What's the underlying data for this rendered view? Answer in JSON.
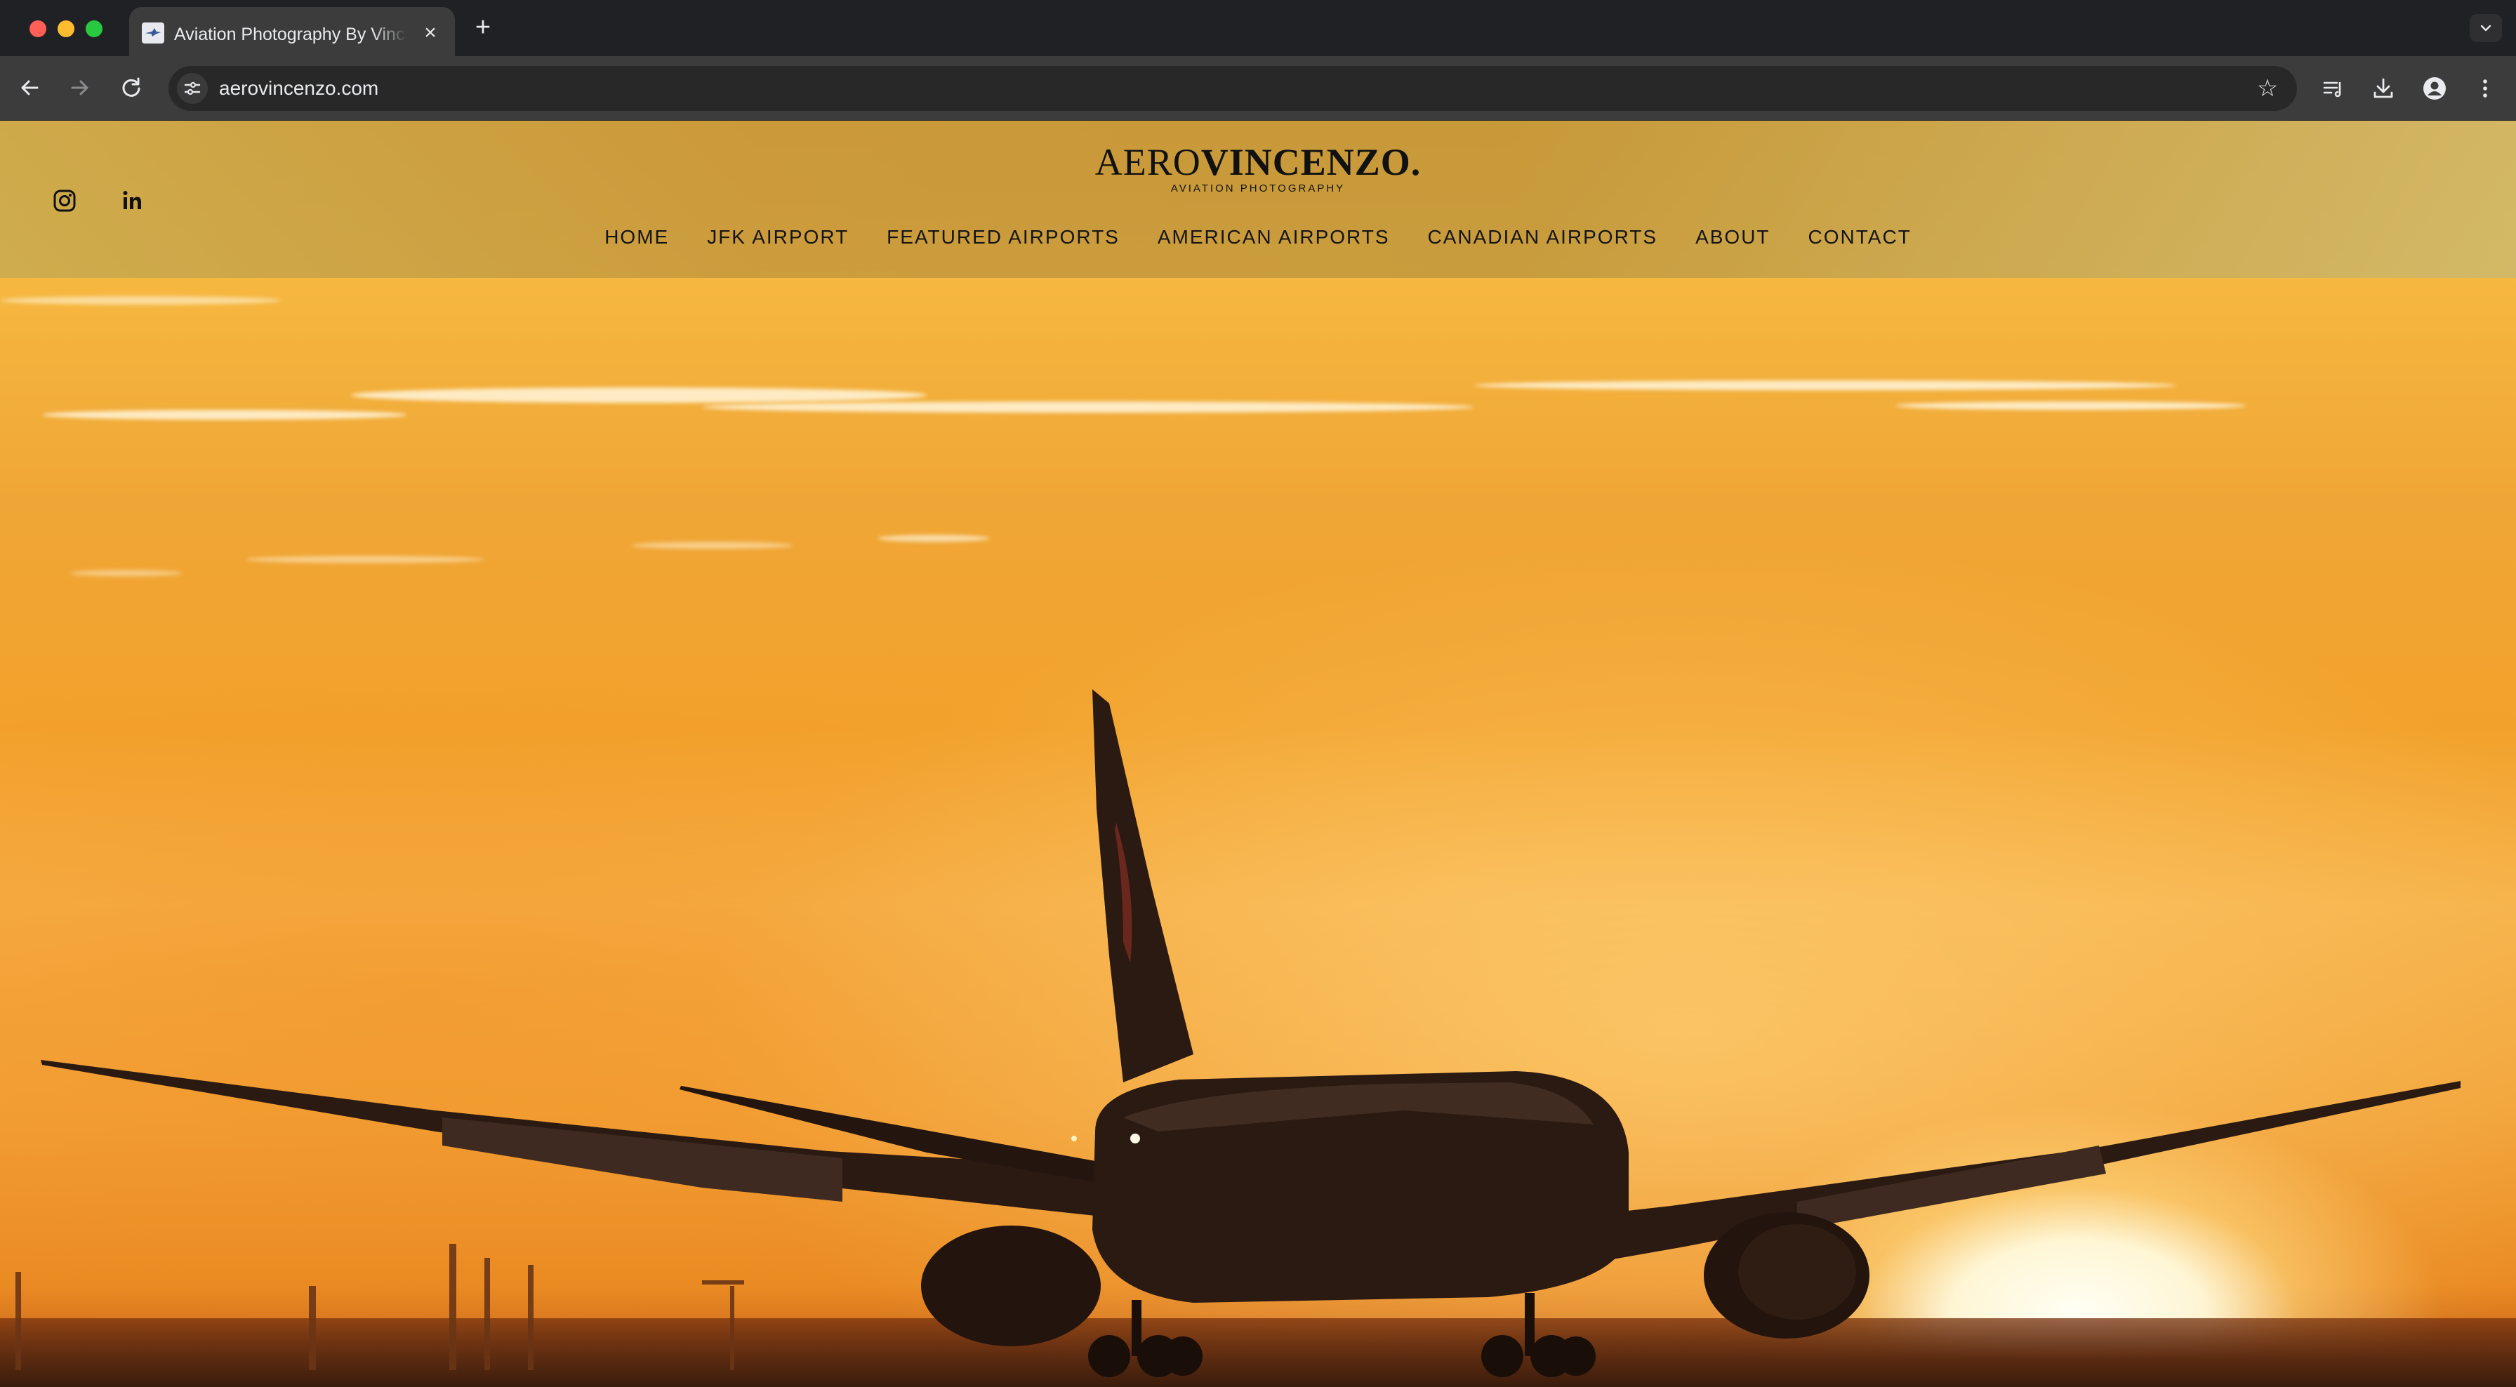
{
  "browser": {
    "tab": {
      "title": "Aviation Photography By Vinc",
      "close_icon": "×",
      "favicon": "site-favicon"
    },
    "new_tab_icon": "+",
    "tab_dropdown_icon": "⌄",
    "nav": {
      "back_icon": "←",
      "forward_icon": "→",
      "reload_icon": "↻"
    },
    "url": "aerovincenzo.com",
    "bookmark_icon": "☆"
  },
  "site": {
    "logo": {
      "part1": "AERO",
      "part2": "VINCENZO.",
      "tagline": "AVIATION PHOTOGRAPHY"
    },
    "social": [
      {
        "name": "instagram-icon"
      },
      {
        "name": "linkedin-icon",
        "glyph": "in"
      }
    ],
    "nav": [
      {
        "label": "HOME"
      },
      {
        "label": "JFK AIRPORT"
      },
      {
        "label": "FEATURED AIRPORTS"
      },
      {
        "label": "AMERICAN AIRPORTS"
      },
      {
        "label": "CANADIAN AIRPORTS"
      },
      {
        "label": "ABOUT"
      },
      {
        "label": "CONTACT"
      }
    ]
  },
  "hero": {
    "accent_sky": "#f2a22c",
    "sun": "#fffaf0",
    "silhouette": "#2a1a12"
  }
}
